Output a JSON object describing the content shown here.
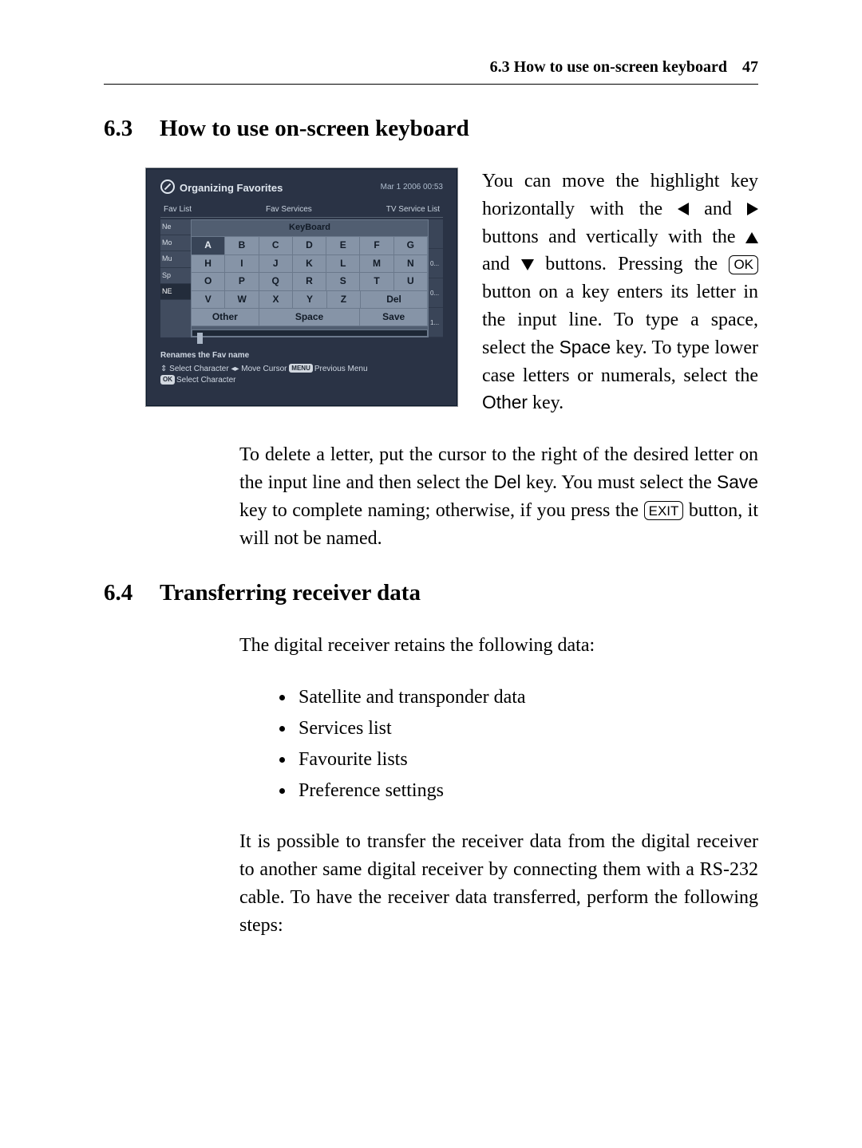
{
  "page": {
    "running_header": "6.3 How to use on-screen keyboard",
    "page_number": "47"
  },
  "section63": {
    "number": "6.3",
    "title": "How to use on-screen keyboard"
  },
  "screenshot": {
    "title": "Organizing Favorites",
    "datetime": "Mar 1 2006 00:53",
    "tab_left": "Fav List",
    "tab_mid": "Fav Services",
    "tab_right": "TV Service List",
    "left_items": [
      "Ne",
      "Mo",
      "Mu",
      "Sp",
      "NE"
    ],
    "right_items": [
      "",
      "0...",
      "0...",
      "1..."
    ],
    "kb_label": "KeyBoard",
    "rows": {
      "r1": [
        "A",
        "B",
        "C",
        "D",
        "E",
        "F",
        "G"
      ],
      "r2": [
        "H",
        "I",
        "J",
        "K",
        "L",
        "M",
        "N"
      ],
      "r3": [
        "O",
        "P",
        "Q",
        "R",
        "S",
        "T",
        "U"
      ],
      "r4": [
        "V",
        "W",
        "X",
        "Y",
        "Z",
        "Del"
      ],
      "r5": [
        "Other",
        "Space",
        "Save"
      ]
    },
    "footer1": "Renames the Fav name",
    "footer2a": "Select Character",
    "footer2b": "Move Cursor",
    "footer2c_pill": "MENU",
    "footer2c": "Previous Menu",
    "footer3_pill": "OK",
    "footer3": "Select Character"
  },
  "aside": {
    "t1": "You can move the highlight key horizontally with the ",
    "t2": " and ",
    "t3": " buttons and vertically with the ",
    "t4": " and ",
    "t5": " buttons. Pressing the ",
    "ok": "OK",
    "t6": " button on a key enters its letter in the input line. To type a space, select the ",
    "space_key": "Space",
    "t7": " key. To type lower case letters or numerals, select the ",
    "other_key": "Other",
    "t8": " key."
  },
  "para2": {
    "t1": "To delete a letter, put the cursor to the right of the desired letter on the input line and then select the ",
    "del_key": "Del",
    "t2": " key. You must select the ",
    "save_key": "Save",
    "t3": " key to complete naming; otherwise, if you press the ",
    "exit": "EXIT",
    "t4": " button, it will not be named."
  },
  "section64": {
    "number": "6.4",
    "title": "Transferring receiver data"
  },
  "para3": "The digital receiver retains the following data:",
  "bullets": [
    "Satellite and transponder data",
    "Services list",
    "Favourite lists",
    "Preference settings"
  ],
  "para4": "It is possible to transfer the receiver data from the digital receiver to another same digital receiver by connecting them with a RS-232 cable. To have the receiver data transferred, perform the following steps:"
}
